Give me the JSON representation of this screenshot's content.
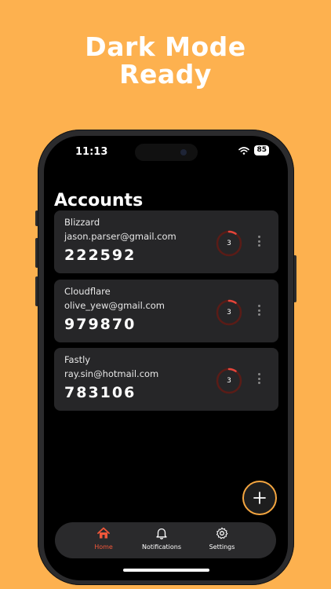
{
  "headline": {
    "line1": "Dark Mode",
    "line2": "Ready"
  },
  "status_bar": {
    "time": "11:13",
    "battery": "85"
  },
  "page": {
    "title": "Accounts"
  },
  "accounts": [
    {
      "issuer": "Blizzard",
      "email": "jason.parser@gmail.com",
      "code": "222592",
      "timer": "3"
    },
    {
      "issuer": "Cloudflare",
      "email": "olive_yew@gmail.com",
      "code": "979870",
      "timer": "3"
    },
    {
      "issuer": "Fastly",
      "email": "ray.sin@hotmail.com",
      "code": "783106",
      "timer": "3"
    }
  ],
  "tabs": [
    {
      "label": "Home",
      "icon": "home-icon",
      "active": true
    },
    {
      "label": "Notifications",
      "icon": "bell-icon",
      "active": false
    },
    {
      "label": "Settings",
      "icon": "gear-icon",
      "active": false
    }
  ],
  "colors": {
    "background": "#FDB14F",
    "accent": "#F1573A",
    "fab_border": "#F5A640",
    "card": "#262628"
  }
}
